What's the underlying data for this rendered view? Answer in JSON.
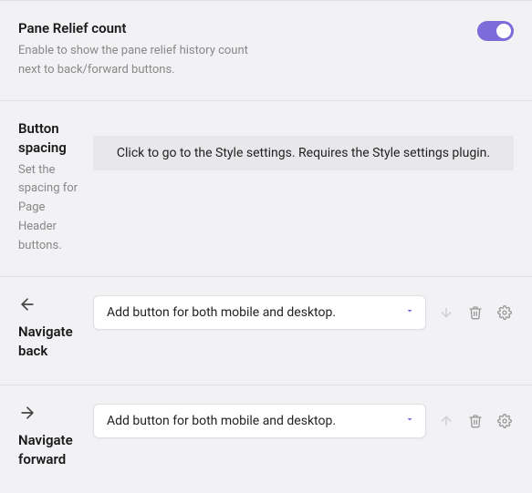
{
  "settings": {
    "paneRelief": {
      "name": "Pane Relief count",
      "desc": "Enable to show the pane relief history count next to back/forward buttons.",
      "enabled": true
    },
    "buttonSpacing": {
      "name": "Button spacing",
      "desc": "Set the spacing for Page Header buttons.",
      "bannerText": "Click to go to the Style settings. Requires the Style settings plugin."
    },
    "navBack": {
      "name": "Navigate back",
      "selectValue": "Add button for both mobile and desktop."
    },
    "navForward": {
      "name": "Navigate forward",
      "selectValue": "Add button for both mobile and desktop."
    }
  }
}
